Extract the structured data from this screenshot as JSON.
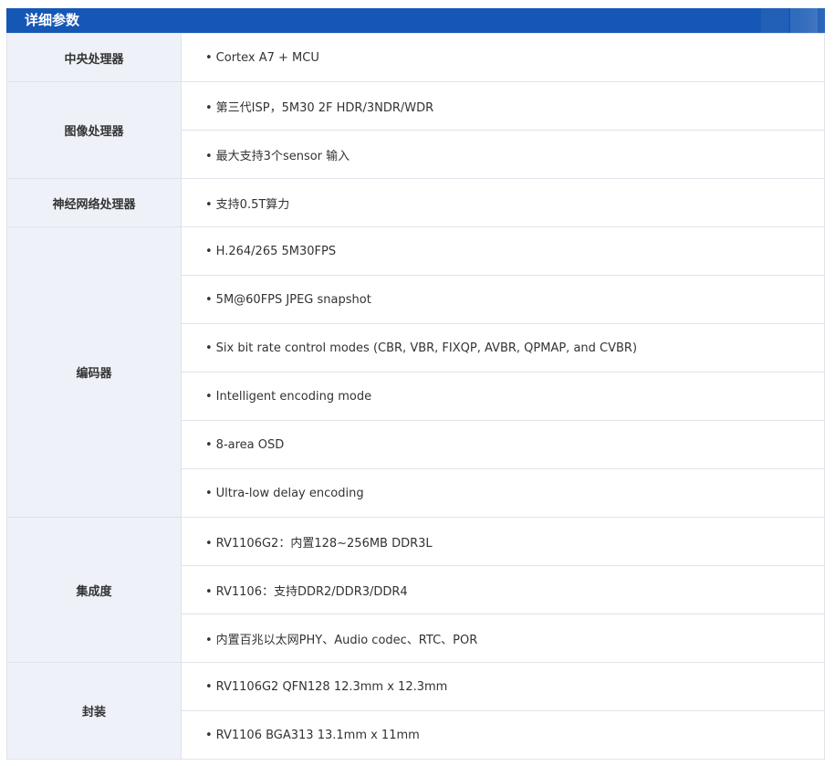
{
  "header": {
    "title": "详细参数"
  },
  "groups": [
    {
      "label": "中央处理器",
      "items": [
        "Cortex A7 + MCU"
      ]
    },
    {
      "label": "图像处理器",
      "items": [
        "第三代ISP，5M30 2F HDR/3NDR/WDR",
        "最大支持3个sensor 输入"
      ]
    },
    {
      "label": "神经网络处理器",
      "items": [
        "支持0.5T算力"
      ]
    },
    {
      "label": "编码器",
      "items": [
        "H.264/265 5M30FPS",
        "5M@60FPS JPEG snapshot",
        "Six bit rate control modes (CBR, VBR, FIXQP, AVBR, QPMAP, and CVBR)",
        "Intelligent encoding mode",
        "8-area OSD",
        "Ultra-low delay encoding"
      ]
    },
    {
      "label": "集成度",
      "items": [
        "RV1106G2：内置128~256MB DDR3L",
        "RV1106：支持DDR2/DDR3/DDR4",
        "内置百兆以太网PHY、Audio codec、RTC、POR"
      ]
    },
    {
      "label": "封装",
      "items": [
        "RV1106G2 QFN128 12.3mm x 12.3mm",
        "RV1106 BGA313 13.1mm x 11mm"
      ]
    }
  ],
  "bullet": "•"
}
